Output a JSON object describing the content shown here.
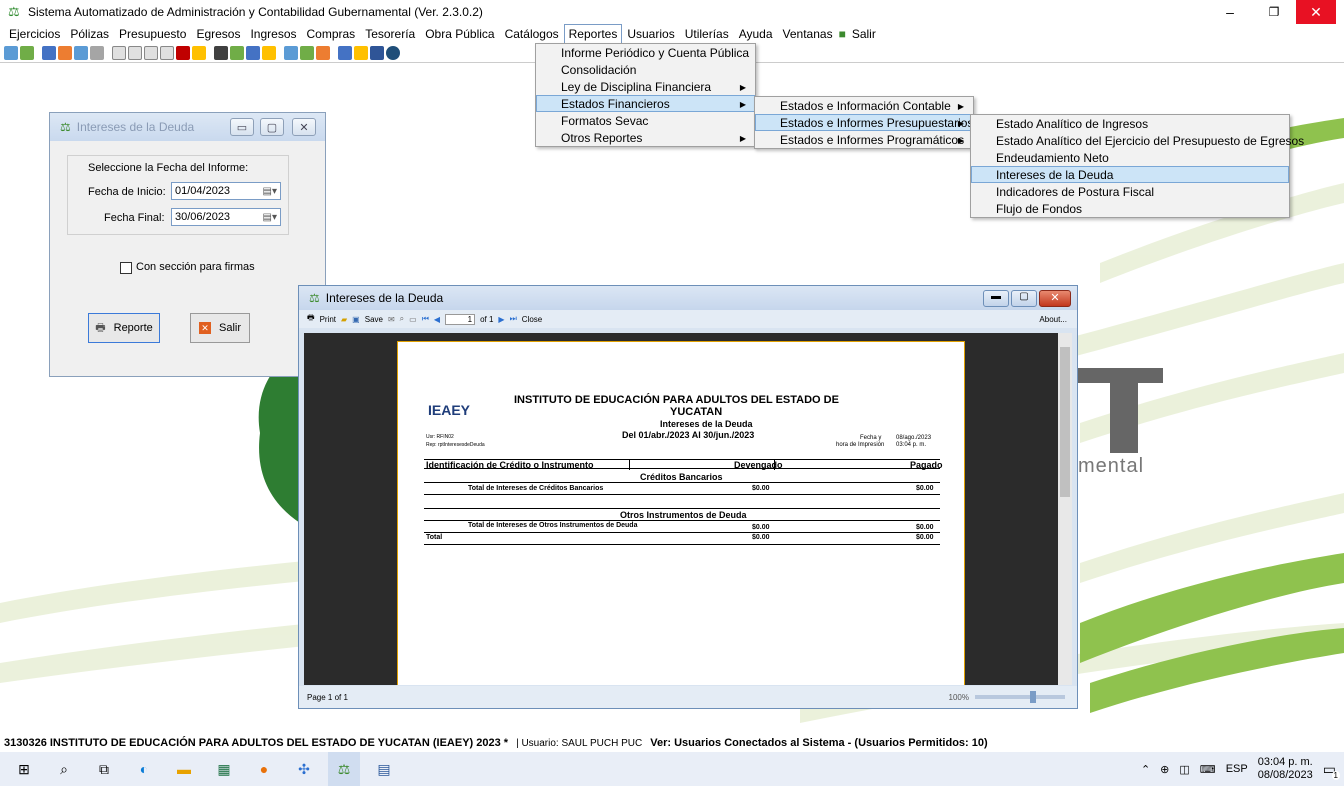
{
  "window": {
    "title": "Sistema Automatizado de Administración y Contabilidad Gubernamental (Ver. 2.3.0.2)",
    "minimize": "–",
    "maximize": "❐",
    "close": "✕"
  },
  "menu": {
    "items": [
      "Ejercicios",
      "Pólizas",
      "Presupuesto",
      "Egresos",
      "Ingresos",
      "Compras",
      "Tesorería",
      "Obra Pública",
      "Catálogos",
      "Reportes",
      "Usuarios",
      "Utilerías",
      "Ayuda",
      "Ventanas",
      "Salir"
    ],
    "active": "Reportes"
  },
  "reportes_menu": {
    "items": [
      "Informe Periódico y Cuenta Pública",
      "Consolidación",
      "Ley de Disciplina Financiera",
      "Estados Financieros",
      "Formatos Sevac",
      "Otros Reportes"
    ]
  },
  "estados_menu": {
    "items": [
      "Estados e Información Contable",
      "Estados e Informes Presupuestarios",
      "Estados e Informes Programáticos"
    ]
  },
  "presupuestarios_menu": {
    "items": [
      "Estado Analítico de Ingresos",
      "Estado Analítico del Ejercicio del Presupuesto de Egresos",
      "Endeudamiento Neto",
      "Intereses de la Deuda",
      "Indicadores de Postura Fiscal",
      "Flujo de Fondos"
    ]
  },
  "dialog": {
    "title": "Intereses de la Deuda",
    "group_label": "Seleccione la Fecha del Informe:",
    "fecha_inicio_label": "Fecha de Inicio:",
    "fecha_inicio": "01/04/2023",
    "fecha_final_label": "Fecha Final:",
    "fecha_final": "30/06/2023",
    "firmas_label": "Con sección para firmas",
    "reporte_button": "Reporte",
    "salir_button": "Salir"
  },
  "viewer": {
    "title": "Intereses de la Deuda",
    "toolbar": {
      "print": "Print",
      "save": "Save",
      "page_input": "1",
      "page_of": "of 1",
      "close": "Close",
      "about": "About..."
    },
    "status": "Page 1 of 1",
    "zoom": "100%"
  },
  "report": {
    "logo": "IEAEY",
    "header1": "INSTITUTO DE EDUCACIÓN PARA ADULTOS DEL ESTADO DE",
    "header2": "YUCATAN",
    "header3": "Intereses de la Deuda",
    "header4": "Del 01/abr./2023 Al 30/jun./2023",
    "usr": "Usr: RFIN02",
    "rep": "Rep: rptInteresesdeDeuda",
    "fecha_label": "Fecha y",
    "fecha_value": "08/ago./2023",
    "hora_label": "hora de Impresión",
    "hora_value": "03:04 p. m.",
    "columns": [
      "Identificación de Crédito o Instrumento",
      "Devengado",
      "Pagado"
    ],
    "section1": "Créditos Bancarios",
    "row1": {
      "label": "Total de Intereses de Créditos Bancarios",
      "devengado": "$0.00",
      "pagado": "$0.00"
    },
    "section2": "Otros Instrumentos de Deuda",
    "row2": {
      "label": "Total de Intereses de Otros Instrumentos de Deuda",
      "devengado": "$0.00",
      "pagado": "$0.00"
    },
    "total": {
      "label": "Total",
      "devengado": "$0.00",
      "pagado": "$0.00"
    }
  },
  "background_text": "mental",
  "statusbar": {
    "entity": "3130326 INSTITUTO DE EDUCACIÓN PARA ADULTOS DEL ESTADO DE YUCATAN (IEAEY)  2023   *",
    "usuario": "| Usuario: SAUL PUCH PUC",
    "ver": "Ver: Usuarios Conectados al Sistema - (Usuarios Permitidos: 10)"
  },
  "taskbar": {
    "lang": "ESP",
    "time": "03:04 p. m.",
    "date": "08/08/2023",
    "badge": "1"
  },
  "colors": {
    "accent": "#0078d7",
    "highlight": "#cce4f7",
    "green": "#3c8a2e"
  }
}
